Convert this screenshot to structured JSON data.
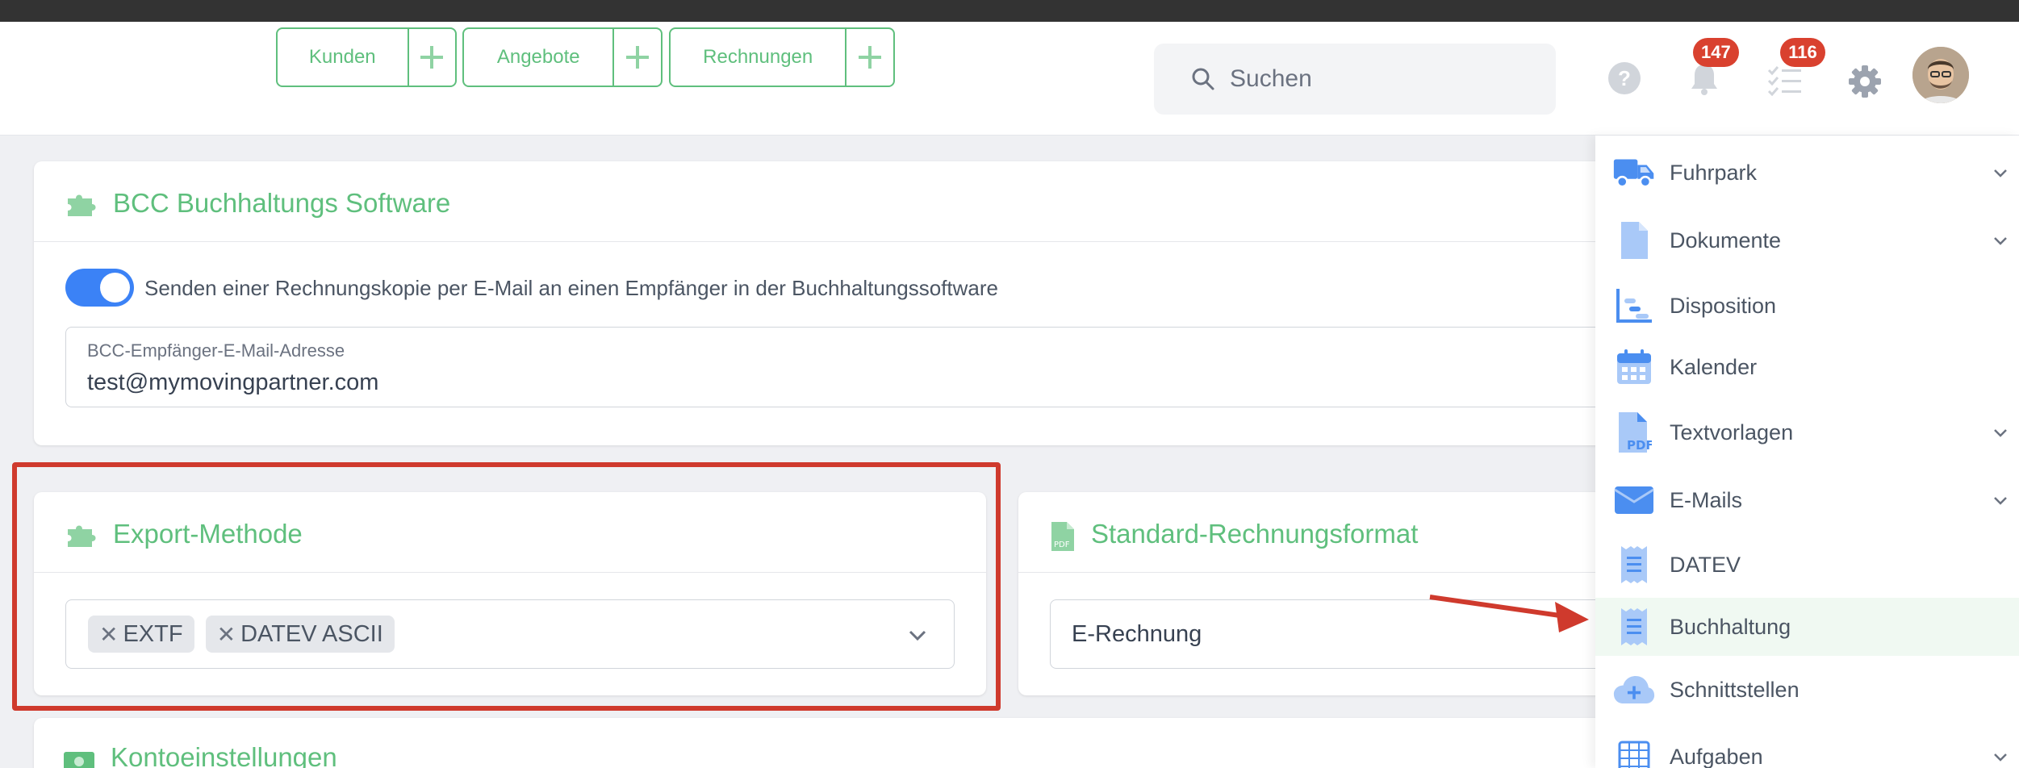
{
  "header": {
    "quick_actions": [
      {
        "label": "Kunden"
      },
      {
        "label": "Angebote"
      },
      {
        "label": "Rechnungen"
      }
    ],
    "search_placeholder": "Suchen",
    "notifications_count": "147",
    "tasks_count": "116"
  },
  "bcc_card": {
    "title": "BCC Buchhaltungs Software",
    "toggle_label": "Senden einer Rechnungskopie per E-Mail an einen Empfänger in der Buchhaltungssoftware",
    "toggle_on": true,
    "email_label": "BCC-Empfänger-E-Mail-Adresse",
    "email_value": "test@mymovingpartner.com"
  },
  "export_card": {
    "title": "Export-Methode",
    "chips": [
      "EXTF",
      "DATEV ASCII"
    ]
  },
  "format_card": {
    "title": "Standard-Rechnungsformat",
    "value": "E-Rechnung"
  },
  "konto_card": {
    "title": "Kontoeinstellungen"
  },
  "sidebar": {
    "items": [
      {
        "label": "Fuhrpark",
        "icon": "truck-icon",
        "expandable": true
      },
      {
        "label": "Dokumente",
        "icon": "document-icon",
        "expandable": true
      },
      {
        "label": "Disposition",
        "icon": "gantt-chart-icon",
        "expandable": false
      },
      {
        "label": "Kalender",
        "icon": "calendar-icon",
        "expandable": false
      },
      {
        "label": "Textvorlagen",
        "icon": "pdf-file-icon",
        "expandable": true
      },
      {
        "label": "E-Mails",
        "icon": "envelope-icon",
        "expandable": true
      },
      {
        "label": "DATEV",
        "icon": "receipt-icon",
        "expandable": false
      },
      {
        "label": "Buchhaltung",
        "icon": "receipt-icon",
        "expandable": false,
        "active": true
      },
      {
        "label": "Schnittstellen",
        "icon": "cloud-plus-icon",
        "expandable": false
      },
      {
        "label": "Aufgaben",
        "icon": "calendar-grid-icon",
        "expandable": true
      }
    ]
  },
  "colors": {
    "accent_green": "#5fbf7d",
    "toggle_blue": "#3b82f6",
    "badge_red": "#d9412f",
    "highlight_red": "#cf3a2d",
    "icon_blue": "#4b8ef0"
  }
}
